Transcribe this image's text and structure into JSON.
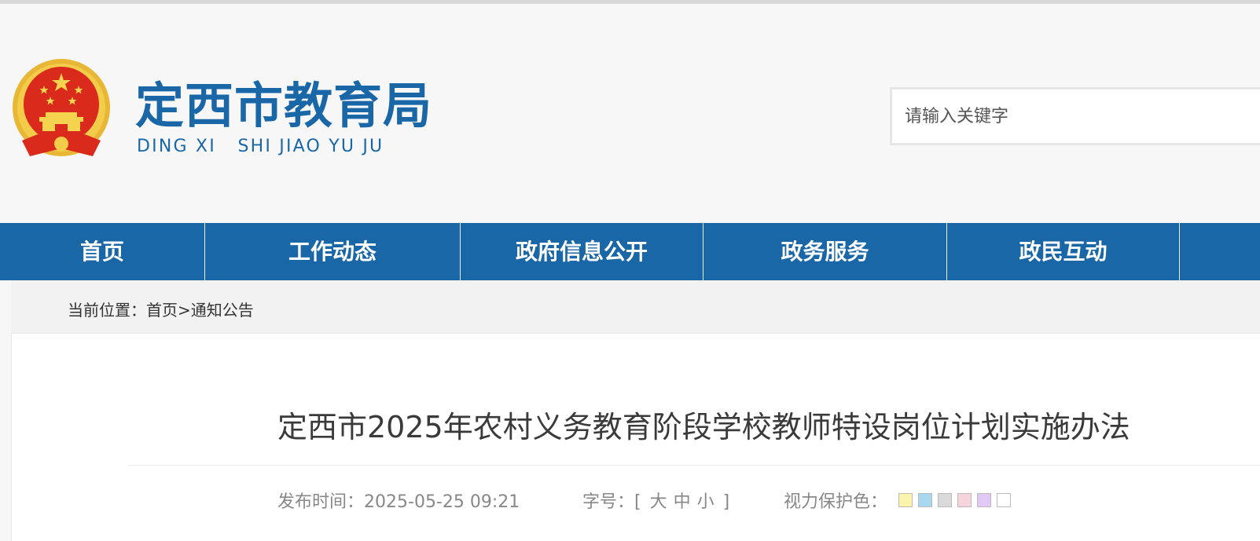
{
  "header": {
    "title": "定西市教育局",
    "subtitle": "DING XI   SHI JIAO YU JU",
    "search_placeholder": "请输入关键字"
  },
  "nav": {
    "items": [
      "首页",
      "工作动态",
      "政府信息公开",
      "政务服务",
      "政民互动"
    ]
  },
  "breadcrumb": {
    "prefix": "当前位置：",
    "home": "首页",
    "separator": ">",
    "current": "通知公告"
  },
  "article": {
    "title": "定西市2025年农村义务教育阶段学校教师特设岗位计划实施办法",
    "publish_label": "发布时间：",
    "publish_time": "2025-05-25 09:21",
    "font_size_label": "字号：",
    "bracket_open": "[",
    "size_large": "大",
    "size_medium": "中",
    "size_small": "小",
    "bracket_close": "]",
    "eye_care_label": "视力保护色："
  },
  "eye_care_colors": [
    "#faf4ad",
    "#a7d8f0",
    "#dadada",
    "#f6d4dc",
    "#e2c8f4",
    "#ffffff"
  ],
  "colors": {
    "brand": "#1a67a8",
    "nav_text": "#ffffff"
  }
}
